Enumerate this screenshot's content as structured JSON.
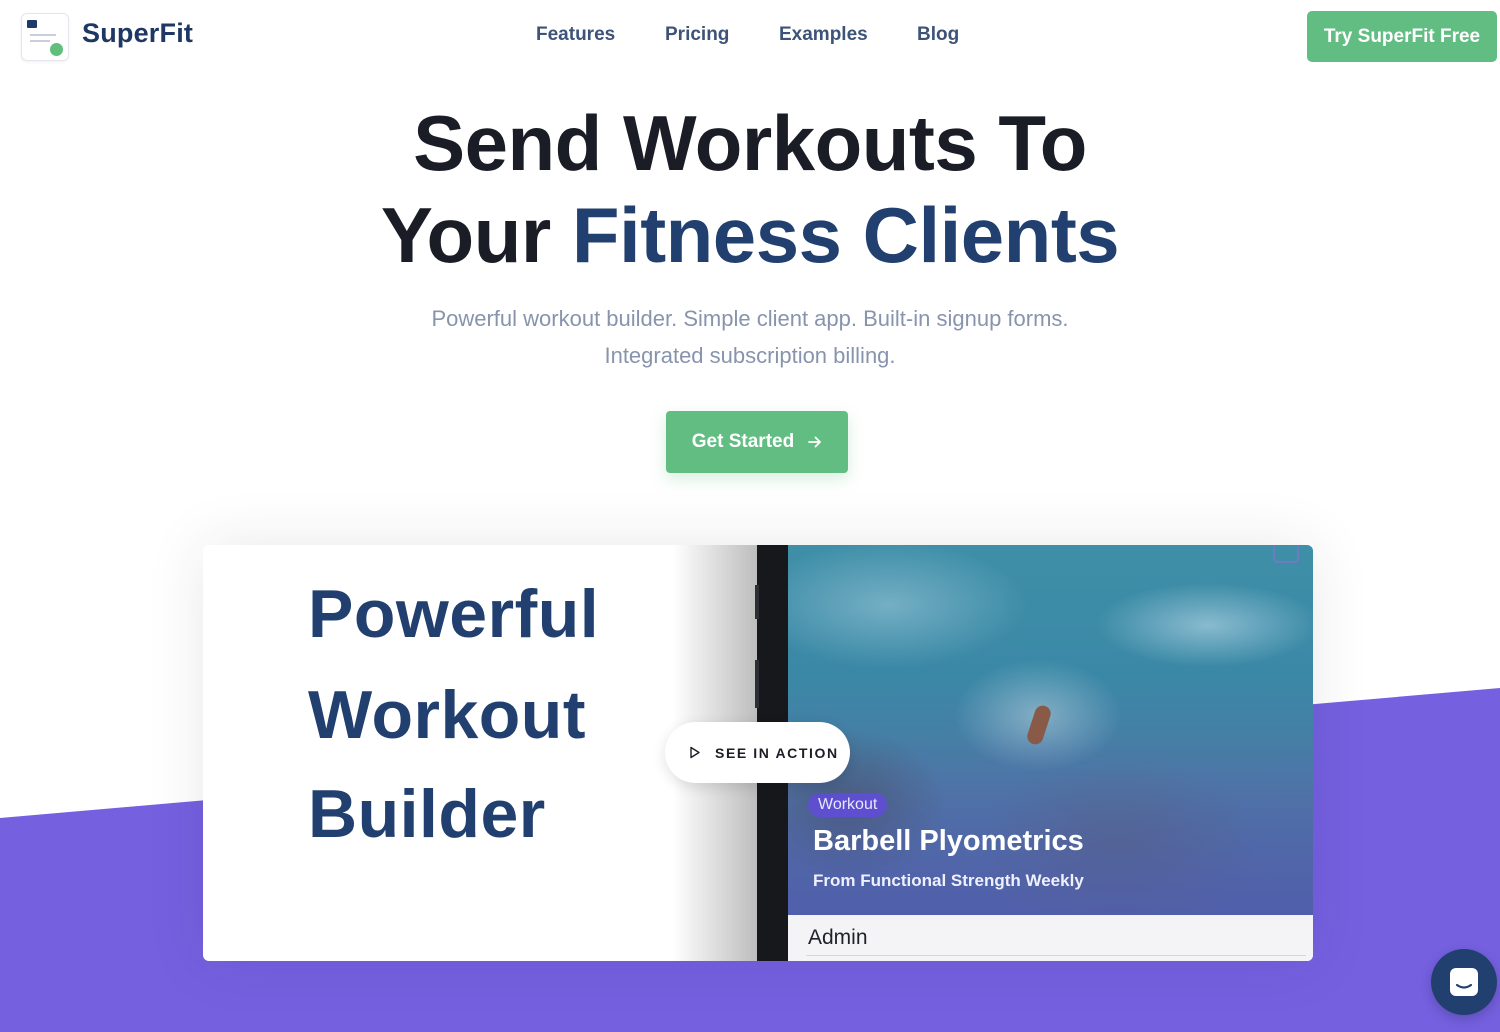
{
  "header": {
    "brand": "SuperFit",
    "nav": [
      "Features",
      "Pricing",
      "Examples",
      "Blog"
    ],
    "cta": "Try SuperFit Free"
  },
  "hero": {
    "line1": "Send Workouts To",
    "line2_plain": "Your ",
    "line2_accent": "Fitness Clients",
    "sub1": "Powerful workout builder. Simple client app. Built-in signup forms.",
    "sub2": "Integrated subscription billing.",
    "button": "Get Started",
    "button_icon": "arrow-right-icon"
  },
  "video": {
    "headline": [
      "Powerful",
      "Workout",
      "Builder"
    ],
    "see_action": "SEE IN ACTION",
    "play_icon": "play-icon",
    "workout_tag": "Workout",
    "workout_title": "Barbell Plyometrics",
    "workout_sub": "From Functional Strength Weekly",
    "admin": "Admin"
  },
  "chat": {
    "icon": "chat-icon"
  },
  "colors": {
    "green": "#62bd82",
    "navy": "#22406f",
    "purple": "#7560e0"
  }
}
